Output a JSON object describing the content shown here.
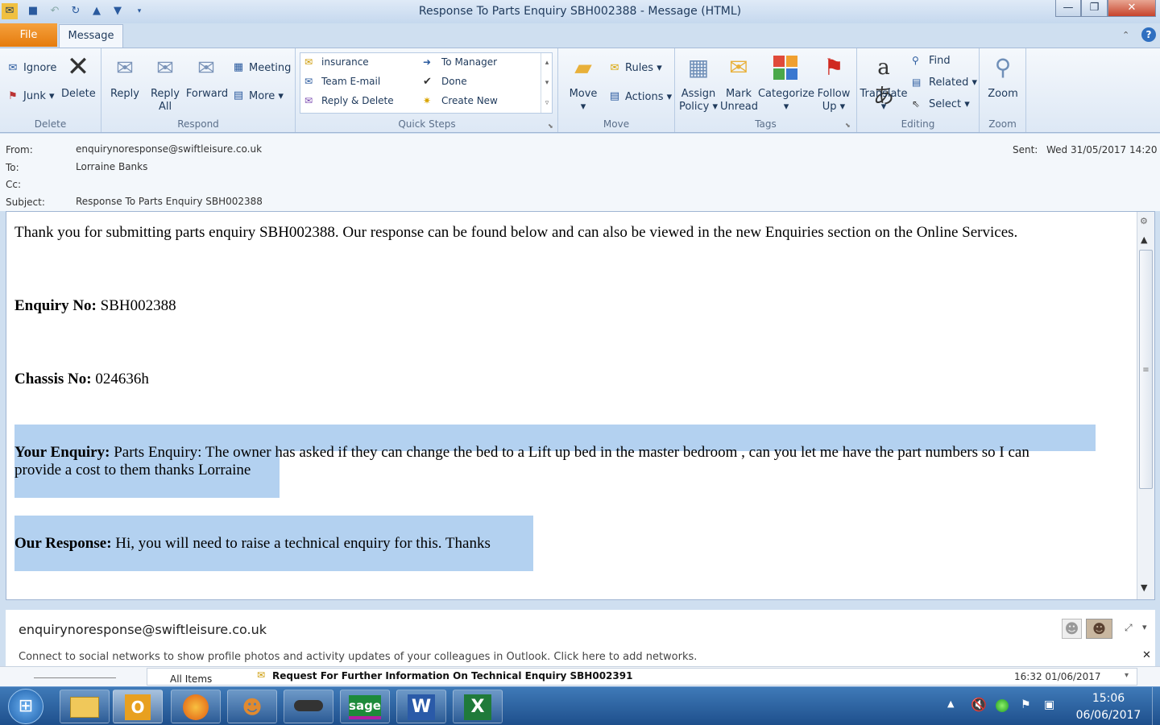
{
  "window": {
    "title": "Response To Parts Enquiry SBH002388 - Message (HTML)",
    "controls": {
      "minimize": "—",
      "maximize": "❐",
      "close": "✕"
    }
  },
  "qat": {
    "icons": [
      "outlook-icon",
      "save-icon",
      "undo-icon",
      "redo-icon",
      "up-icon",
      "down-icon",
      "customize-icon"
    ]
  },
  "tabs": {
    "file": "File",
    "message": "Message"
  },
  "ribbon": {
    "delete": {
      "label": "Delete",
      "ignore": "Ignore",
      "junk": "Junk",
      "delete": "Delete"
    },
    "respond": {
      "label": "Respond",
      "reply": "Reply",
      "reply_all_1": "Reply",
      "reply_all_2": "All",
      "forward": "Forward",
      "meeting": "Meeting",
      "more": "More"
    },
    "quicksteps": {
      "label": "Quick Steps",
      "items": [
        "insurance",
        "To Manager",
        "Team E-mail",
        "Done",
        "Reply & Delete",
        "Create New"
      ]
    },
    "move": {
      "label": "Move",
      "move": "Move",
      "rules": "Rules",
      "actions": "Actions"
    },
    "tags": {
      "label": "Tags",
      "assign_1": "Assign",
      "assign_2": "Policy",
      "mark_1": "Mark",
      "mark_2": "Unread",
      "categorize": "Categorize",
      "follow_1": "Follow",
      "follow_2": "Up"
    },
    "editing": {
      "label": "Editing",
      "translate": "Translate",
      "find": "Find",
      "related": "Related",
      "select": "Select"
    },
    "zoom": {
      "label": "Zoom",
      "zoom": "Zoom"
    }
  },
  "header": {
    "from_label": "From:",
    "from": "enquirynoresponse@swiftleisure.co.uk",
    "to_label": "To:",
    "to": "Lorraine Banks",
    "cc_label": "Cc:",
    "cc": "",
    "subject_label": "Subject:",
    "subject": "Response To Parts Enquiry SBH002388",
    "sent_label": "Sent:",
    "sent": "Wed 31/05/2017 14:20"
  },
  "message": {
    "intro": "Thank you for submitting parts enquiry SBH002388. Our response can be found below and can also be viewed in the new Enquiries section on the Online Services.",
    "enquiry_no_label": "Enquiry No:",
    "enquiry_no": "SBH002388",
    "chassis_no_label": "Chassis No:",
    "chassis_no": "024636h",
    "your_enquiry_label": "Your Enquiry:",
    "your_enquiry_line1": "Parts Enquiry: The owner has asked if they can change the bed to a Lift up bed in the master bedroom , can you let me have the part numbers so I can",
    "your_enquiry_line2": "provide a cost to them thanks Lorraine",
    "our_response_label": "Our Response:",
    "our_response": "Hi, you will need to raise a technical enquiry for this. Thanks"
  },
  "people_pane": {
    "sender": "enquirynoresponse@swiftleisure.co.uk",
    "social_text": "Connect to social networks to show profile photos and activity updates of your colleagues in Outlook. Click here to add networks."
  },
  "bottom_strip": {
    "folder": "All Items",
    "next_subject": "Request For Further Information On Technical Enquiry SBH002391",
    "next_date": "16:32 01/06/2017"
  },
  "taskbar": {
    "time": "15:06",
    "date": "06/06/2017",
    "sage_label": "sage",
    "apps": [
      "windows-start-icon",
      "file-explorer-icon",
      "outlook-icon",
      "firefox-icon",
      "contacts-icon",
      "stapler-icon",
      "sage-icon",
      "word-icon",
      "excel-icon"
    ]
  }
}
